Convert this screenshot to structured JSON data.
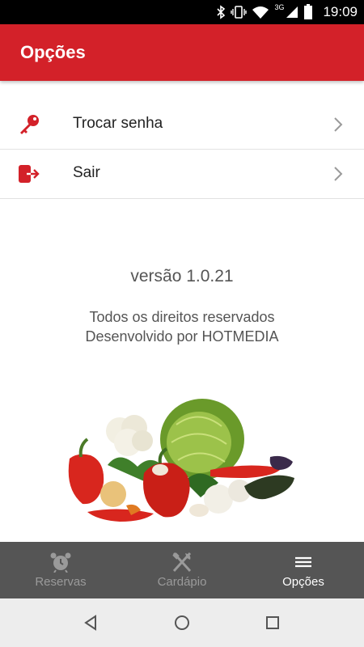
{
  "status_bar": {
    "time": "19:09",
    "network": "3G",
    "icons": [
      "bluetooth-icon",
      "vibrate-icon",
      "wifi-icon",
      "signal-icon",
      "battery-icon"
    ]
  },
  "app_bar": {
    "title": "Opções",
    "background_color": "#d32129"
  },
  "options": [
    {
      "label": "Trocar senha",
      "icon": "key-icon"
    },
    {
      "label": "Sair",
      "icon": "logout-icon"
    }
  ],
  "about": {
    "version": "versão 1.0.21",
    "rights": "Todos os direitos reservados",
    "developer": "Desenvolvido por HOTMEDIA"
  },
  "bottom_nav": {
    "items": [
      {
        "label": "Reservas",
        "icon": "alarm-clock-icon",
        "active": false
      },
      {
        "label": "Cardápio",
        "icon": "fork-knife-icon",
        "active": false
      },
      {
        "label": "Opções",
        "icon": "menu-icon",
        "active": true
      }
    ]
  },
  "colors": {
    "accent": "#d32129",
    "bottom_nav_bg": "#555555",
    "inactive_tab": "#9a9a9a",
    "active_tab": "#ffffff"
  }
}
